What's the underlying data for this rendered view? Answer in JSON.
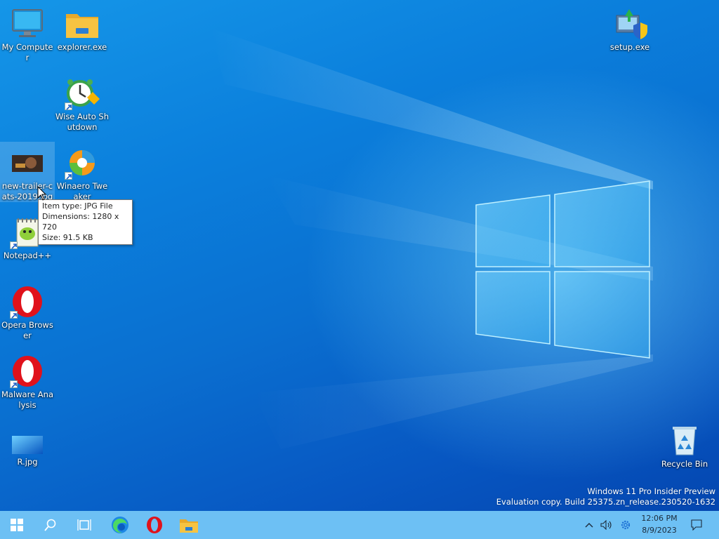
{
  "desktop": {
    "icons": [
      {
        "label": "My Computer"
      },
      {
        "label": "explorer.exe"
      },
      {
        "label": "setup.exe"
      },
      {
        "label": "Wise Auto Shutdown"
      },
      {
        "label": "new-trailer-cats-2019.jpg"
      },
      {
        "label": "Winaero Tweaker"
      },
      {
        "label": "Notepad++"
      },
      {
        "label": "Opera Browser"
      },
      {
        "label": "Malware Analysis"
      },
      {
        "label": "R.jpg"
      },
      {
        "label": "Recycle Bin"
      }
    ]
  },
  "tooltip": {
    "item_type": "Item type: JPG File",
    "dimensions": "Dimensions: 1280 x 720",
    "size": "Size: 91.5 KB"
  },
  "watermark": {
    "line1": "Windows 11 Pro Insider Preview",
    "line2": "Evaluation copy. Build 25375.zn_release.230520-1632"
  },
  "taskbar": {
    "buttons": [
      {
        "icon": "windows-start-icon"
      },
      {
        "icon": "search-icon"
      },
      {
        "icon": "task-view-icon"
      },
      {
        "icon": "edge-icon"
      },
      {
        "icon": "opera-icon"
      },
      {
        "icon": "file-explorer-icon"
      }
    ],
    "tray": {
      "time": "12:06 PM",
      "date": "8/9/2023"
    }
  },
  "colors": {
    "desktop_bg": "#0a78d7",
    "taskbar_bg": "#6dc0f4",
    "opera_red": "#e0121b",
    "folder_yellow": "#f6c342"
  }
}
